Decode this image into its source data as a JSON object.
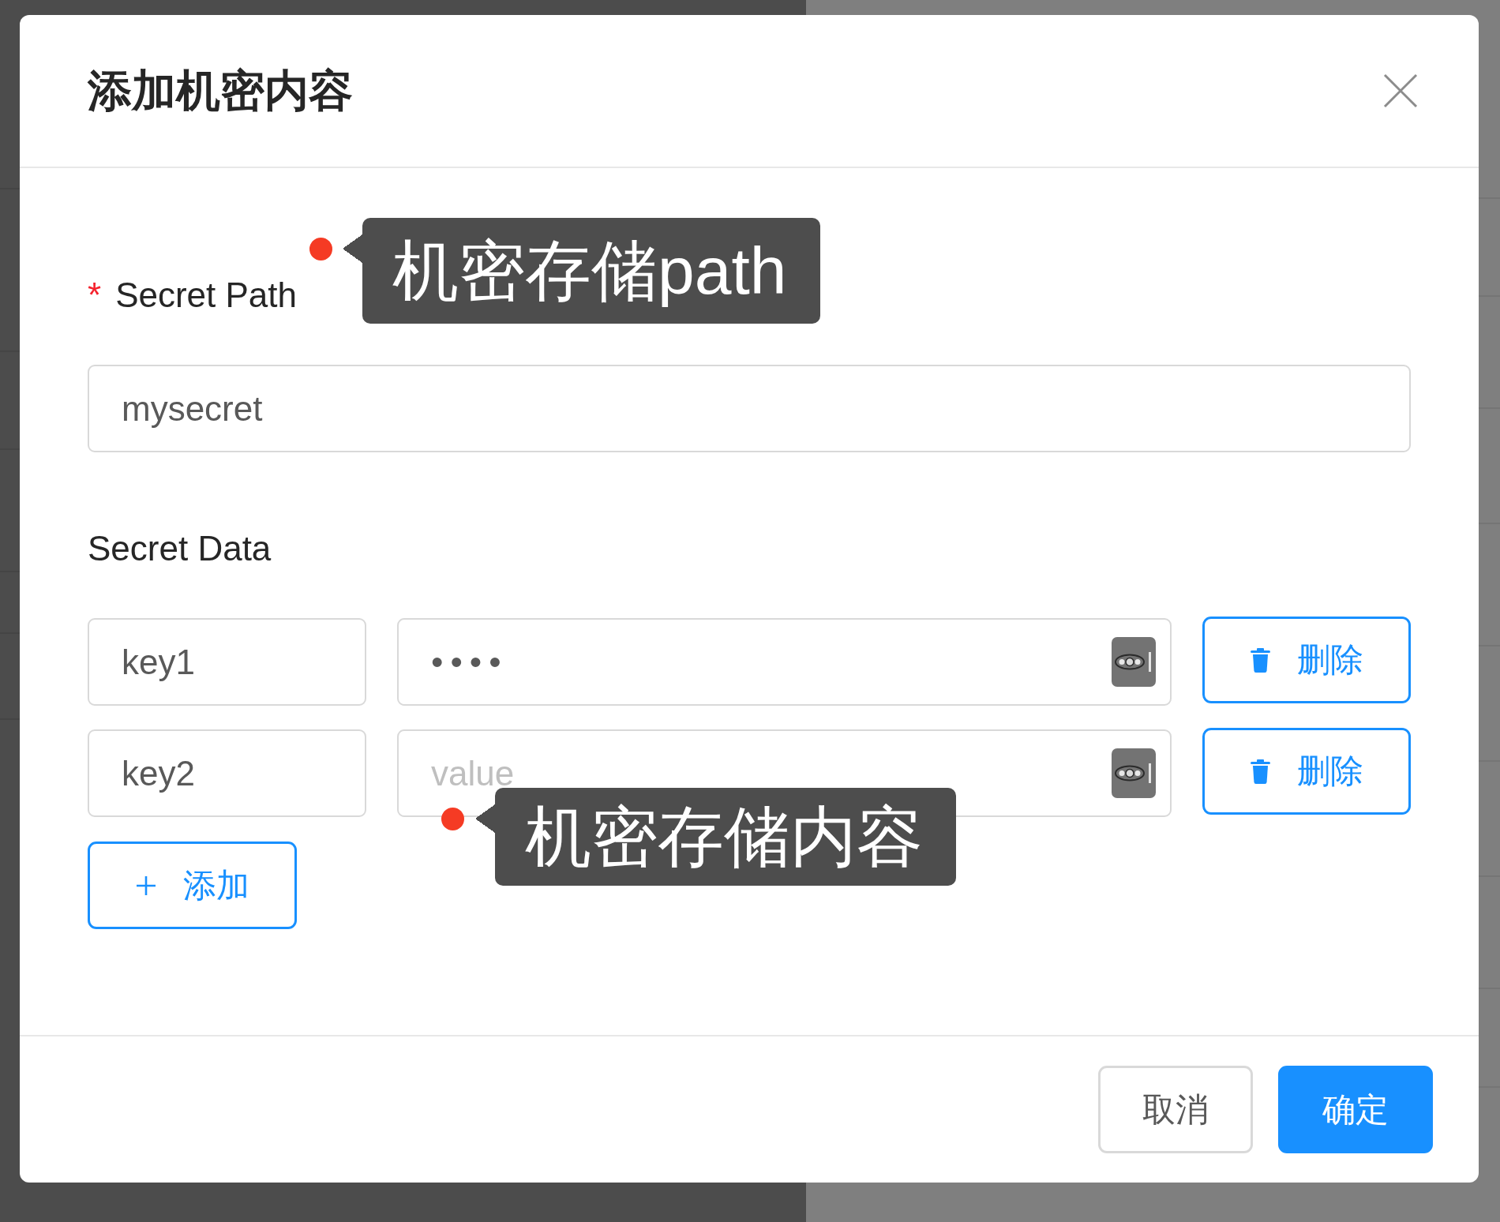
{
  "modal": {
    "title": "添加机密内容"
  },
  "path_field": {
    "required_mark": "*",
    "label": "Secret Path",
    "value": "mysecret",
    "tooltip": "机密存储path"
  },
  "data_section": {
    "label": "Secret Data",
    "rows": [
      {
        "key": "key1",
        "value": "••••",
        "delete_label": "删除"
      },
      {
        "key": "key2",
        "placeholder": "value",
        "delete_label": "删除",
        "tooltip": "机密存储内容"
      }
    ],
    "add_label": "添加"
  },
  "footer": {
    "buttons": [
      {
        "label": "取消",
        "primary": false
      },
      {
        "label": "确定",
        "primary": true
      }
    ]
  }
}
